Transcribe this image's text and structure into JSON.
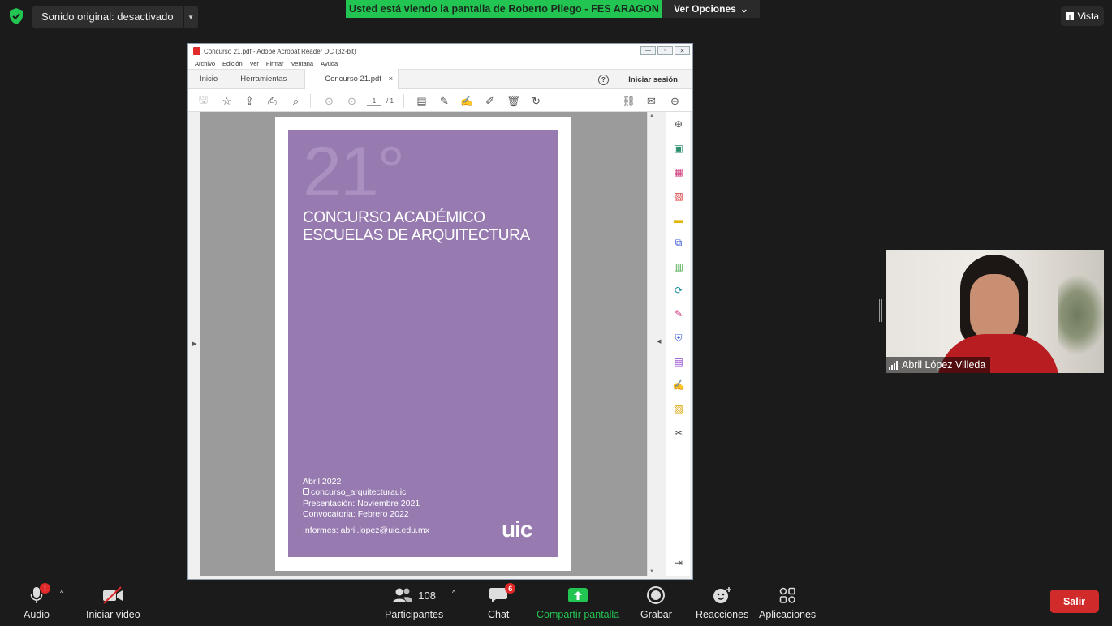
{
  "top_bar": {
    "sound_label": "Sonido original: desactivado",
    "share_banner": "Usted está viendo la pantalla de Roberto Pliego - FES ARAGON",
    "view_options": "Ver Opciones",
    "view_label": "Vista"
  },
  "acrobat": {
    "window_title": "Concurso 21.pdf - Adobe Acrobat Reader DC (32-bit)",
    "menu": [
      "Archivo",
      "Edición",
      "Ver",
      "Firmar",
      "Ventana",
      "Ayuda"
    ],
    "tabs": {
      "home": "Inicio",
      "tools": "Herramientas",
      "document": "Concurso 21.pdf",
      "close": "×"
    },
    "help": "?",
    "sign_in": "Iniciar sesión",
    "page_current": "1",
    "page_total": "/ 1"
  },
  "document": {
    "big_number": "21°",
    "title_line1": "CONCURSO ACADÉMICO",
    "title_line2": "ESCUELAS DE ARQUITECTURA",
    "date": "Abril 2022",
    "instagram": "concurso_arquitecturauic",
    "presentation": "Presentación: Noviembre 2021",
    "call": "Convocatoria: Febrero 2022",
    "contact": "Informes: abril.lopez@uic.edu.mx",
    "logo": "uic"
  },
  "participant": {
    "name": "Abril López Villeda"
  },
  "bottom_bar": {
    "audio": "Audio",
    "audio_badge": "!",
    "video": "Iniciar video",
    "participants": "Participantes",
    "participants_count": "108",
    "chat": "Chat",
    "chat_badge": "6",
    "share": "Compartir pantalla",
    "record": "Grabar",
    "reactions": "Reacciones",
    "apps": "Aplicaciones",
    "leave": "Salir"
  },
  "colors": {
    "banner_green": "#23c552",
    "cover_purple": "#977bb0",
    "leave_red": "#d02a2a"
  }
}
